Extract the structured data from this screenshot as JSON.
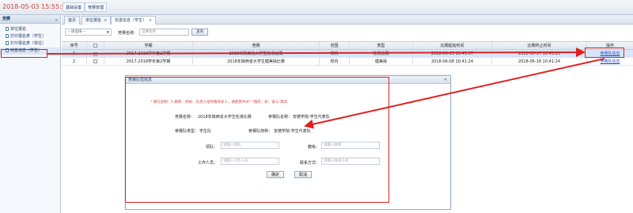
{
  "header": {
    "clock": "2018-05-03 15:55:56",
    "nav": [
      "基础设置",
      "竞赛管理"
    ]
  },
  "sidebar": {
    "title": "竞赛",
    "items": [
      {
        "label": "单位报名"
      },
      {
        "label": "打印报名表（学生）"
      },
      {
        "label": "打印报名表（单位）"
      },
      {
        "label": "完善信息（学生）"
      }
    ]
  },
  "tabs": [
    {
      "label": "首页"
    },
    {
      "label": "单位报名"
    },
    {
      "label": "完善信息（学生）"
    }
  ],
  "filter": {
    "select_value": "---请选择---",
    "name_label": "竞赛名称:",
    "name_placeholder": "竞赛名称",
    "query_button": "查询"
  },
  "table": {
    "headers": [
      "序号",
      "",
      "学期",
      "竞赛",
      "范围",
      "类型",
      "比赛起始时间",
      "比赛终止时间",
      "操作"
    ],
    "rows": [
      {
        "index": "1",
        "checked": true,
        "term": "2017-2018学年第2学期",
        "contest": "2018年陕西省大学生轮滑比赛",
        "scope": "校内",
        "type": "轮滑比赛",
        "start": "2018-06-15 10:43:07",
        "end": "2018-06-17 10:43:13",
        "action": "参赛队信息"
      },
      {
        "index": "2",
        "checked": false,
        "term": "2017-2018学年第2学期",
        "contest": "2018年陕西省大学生健美操比赛",
        "scope": "校内",
        "type": "健美操",
        "start": "2018-06-08 10:41:24",
        "end": "2018-06-18 10:41:24",
        "action": "参赛队信息"
      }
    ]
  },
  "dialog": {
    "title": "竞赛队伍信息",
    "close": "✕",
    "note": "* 填写说明：1.教练：例如：负责人指导教师多人，请使用中文\"-\"隔开；如：张三-李四",
    "contest_label": "竞赛名称：",
    "contest_value": "2018年陕西省大学生轮滑比赛",
    "team_name_label": "参赛队名称：",
    "team_name_value": "安德学院-学生代表队",
    "team_type_label": "参赛队类型：",
    "team_type_value": "学生队",
    "team_abbr_label": "参赛队简称：",
    "team_abbr_value": "安德学院-学生代表队",
    "leader_label": "领队：",
    "leader_placeholder": "请输入领队",
    "coach_label": "教练：",
    "coach_placeholder": "请输入教练",
    "staff_label": "工作人员：",
    "staff_placeholder": "请输入工作人员",
    "contact_label": "联系方式：",
    "contact_placeholder": "请输入联系方式",
    "confirm": "确定",
    "cancel": "取消"
  },
  "colors": {
    "clock": "#d0453c",
    "annotation": "#e02020",
    "link": "#1b45c8"
  }
}
